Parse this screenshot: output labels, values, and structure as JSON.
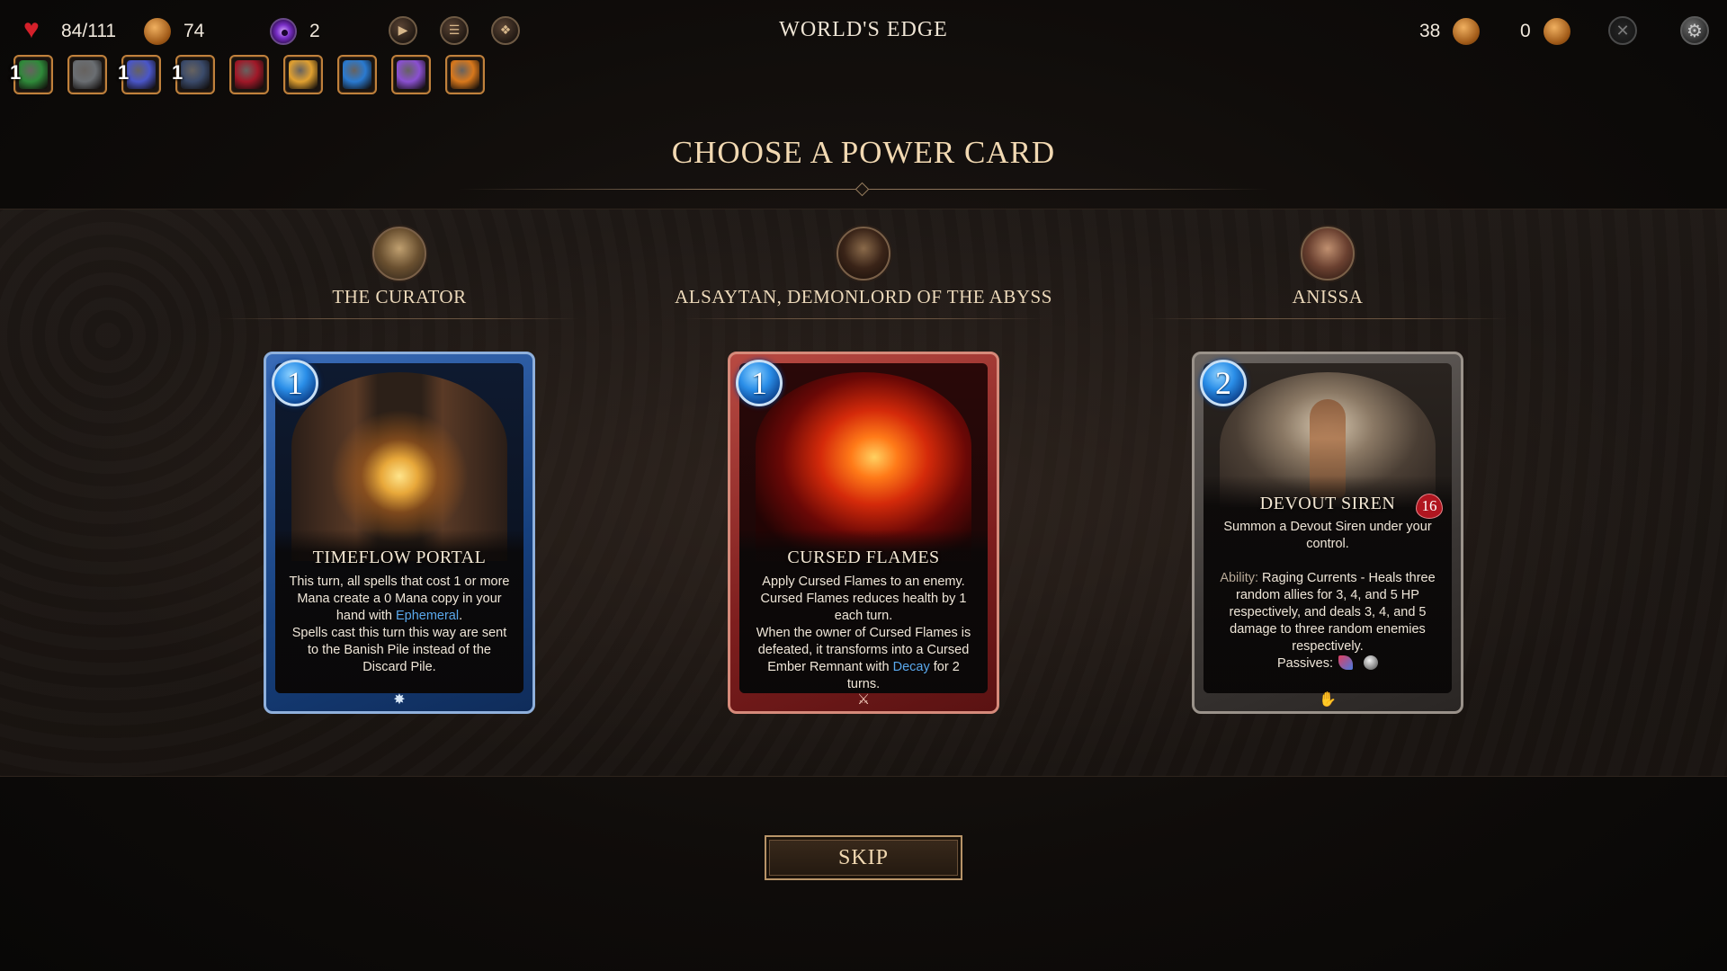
{
  "hud": {
    "health": "84/111",
    "gold": "74",
    "vision": "2",
    "location": "WORLD'S EDGE",
    "shards": "38",
    "crowns": "0",
    "buttons": {
      "play": "play-icon",
      "deck": "deck-icon",
      "map": "map-icon",
      "close": "close-icon",
      "settings": "settings-icon"
    }
  },
  "relics": [
    {
      "name": "green-orb-relic",
      "count": "1",
      "color": "#2f8a3a"
    },
    {
      "name": "stone-egg-relic",
      "count": "",
      "color": "#6a6e72"
    },
    {
      "name": "star-sigil-relic",
      "count": "1",
      "color": "#4a56c8"
    },
    {
      "name": "bat-wing-relic",
      "count": "1",
      "color": "#3a4a6a"
    },
    {
      "name": "crimson-gem-relic",
      "count": "",
      "color": "#a01828"
    },
    {
      "name": "sun-medallion-relic",
      "count": "",
      "color": "#e0a030"
    },
    {
      "name": "blue-tome-relic",
      "count": "",
      "color": "#2a7ad0"
    },
    {
      "name": "potion-pair-relic",
      "count": "",
      "color": "#8a50d0"
    },
    {
      "name": "claw-relic",
      "count": "",
      "color": "#d8781c"
    }
  ],
  "screen": {
    "title": "CHOOSE A POWER CARD",
    "skip": "SKIP"
  },
  "options": [
    {
      "patron": "THE CURATOR",
      "card": {
        "mana": "1",
        "name": "TIMEFLOW PORTAL",
        "desc_1": "This turn, all spells that cost 1 or more Mana create a 0 Mana copy in your hand with ",
        "keyword": "Ephemeral",
        "desc_2": ".",
        "desc_3": "Spells cast this turn this way are sent to the Banish Pile instead of the Discard Pile.",
        "type_icon": "spell-icon",
        "theme": "blue"
      }
    },
    {
      "patron": "ALSAYTAN, DEMONLORD OF THE ABYSS",
      "card": {
        "mana": "1",
        "name": "CURSED FLAMES",
        "desc_1": "Apply Cursed Flames to an enemy.",
        "desc_2": "Cursed Flames reduces health by 1 each turn.",
        "desc_3": "When the owner of Cursed Flames is defeated, it transforms into a Cursed Ember Remnant with ",
        "keyword": "Decay",
        "desc_4": " for 2 turns.",
        "type_icon": "attack-icon",
        "theme": "red"
      }
    },
    {
      "patron": "ANISSA",
      "card": {
        "mana": "2",
        "name": "DEVOUT SIREN",
        "hp": "16",
        "desc_1": "Summon a Devout Siren under your control.",
        "ability_label": "Ability:",
        "ability_text": " Raging Currents - Heals three random allies for 3, 4, and 5 HP respectively, and deals 3, 4, and 5 damage to three random enemies respectively.",
        "passives_label": "Passives:",
        "type_icon": "summon-icon",
        "theme": "grey"
      }
    }
  ]
}
